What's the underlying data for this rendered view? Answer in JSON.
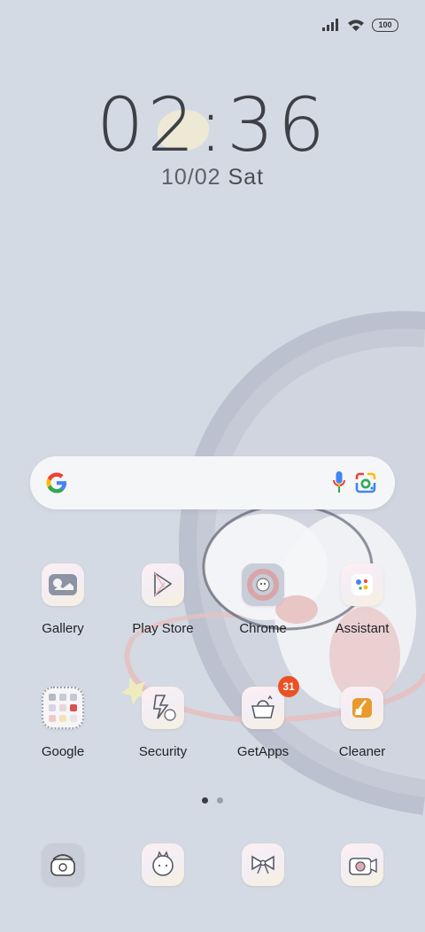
{
  "status": {
    "battery": "100",
    "icons": [
      "signal-icon",
      "wifi-icon",
      "battery-icon"
    ]
  },
  "clock": {
    "time_hours": "02",
    "time_sep": ":",
    "time_minutes": "36",
    "date": "10/02",
    "weekday": "Sat"
  },
  "search": {
    "icons": [
      "google-g-icon",
      "microphone-icon",
      "google-lens-icon"
    ]
  },
  "apps_row1": [
    {
      "label": "Gallery",
      "icon": "gallery-icon"
    },
    {
      "label": "Play Store",
      "icon": "play-store-icon"
    },
    {
      "label": "Chrome",
      "icon": "chrome-icon"
    },
    {
      "label": "Assistant",
      "icon": "assistant-icon"
    }
  ],
  "apps_row2": [
    {
      "label": "Google",
      "icon": "google-folder-icon"
    },
    {
      "label": "Security",
      "icon": "security-icon"
    },
    {
      "label": "GetApps",
      "icon": "getapps-icon",
      "badge": "31"
    },
    {
      "label": "Cleaner",
      "icon": "cleaner-icon"
    }
  ],
  "dock": [
    {
      "icon": "phone-icon"
    },
    {
      "icon": "messages-icon"
    },
    {
      "icon": "ribbon-icon"
    },
    {
      "icon": "camera-icon"
    }
  ],
  "page_indicator": {
    "pages": 2,
    "current": 1
  },
  "colors": {
    "wallpaper": "#d4dae3",
    "badge": "#ea5123",
    "search_bar": "#f5f6f8"
  }
}
